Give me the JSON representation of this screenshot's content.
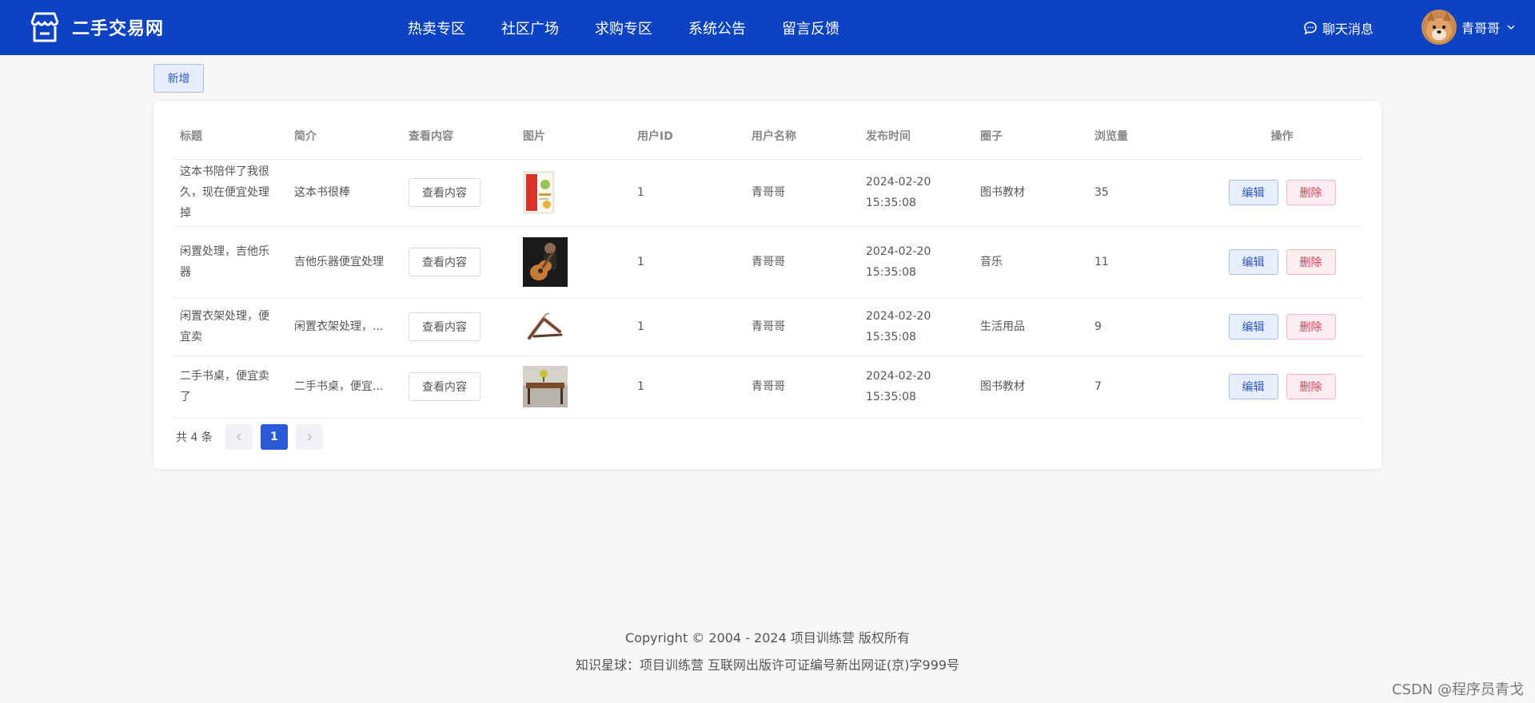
{
  "app": {
    "name": "二手交易网"
  },
  "nav": [
    "热卖专区",
    "社区广场",
    "求购专区",
    "系统公告",
    "留言反馈"
  ],
  "header": {
    "chat_label": "聊天消息",
    "user_name": "青哥哥"
  },
  "toolbar": {
    "add_label": "新增"
  },
  "table": {
    "columns": [
      "标题",
      "简介",
      "查看内容",
      "图片",
      "用户ID",
      "用户名称",
      "发布时间",
      "圈子",
      "浏览量",
      "操作"
    ],
    "rows": [
      {
        "title": "这本书陪伴了我很久，现在便宜处理掉",
        "intro": "这本书很棒",
        "view": "查看内容",
        "image": "book-cover",
        "user_id": "1",
        "user_name": "青哥哥",
        "time": "2024-02-20 15:35:08",
        "circle": "图书教材",
        "views": "35",
        "edit": "编辑",
        "delete": "删除"
      },
      {
        "title": "闲置处理，吉他乐器",
        "intro": "吉他乐器便宜处理",
        "view": "查看内容",
        "image": "guitar",
        "user_id": "1",
        "user_name": "青哥哥",
        "time": "2024-02-20 15:35:08",
        "circle": "音乐",
        "views": "11",
        "edit": "编辑",
        "delete": "删除"
      },
      {
        "title": "闲置衣架处理，便宜卖",
        "intro": "闲置衣架处理，...",
        "view": "查看内容",
        "image": "hanger",
        "user_id": "1",
        "user_name": "青哥哥",
        "time": "2024-02-20 15:35:08",
        "circle": "生活用品",
        "views": "9",
        "edit": "编辑",
        "delete": "删除"
      },
      {
        "title": "二手书桌，便宜卖了",
        "intro": "二手书桌，便宜...",
        "view": "查看内容",
        "image": "desk",
        "user_id": "1",
        "user_name": "青哥哥",
        "time": "2024-02-20 15:35:08",
        "circle": "图书教材",
        "views": "7",
        "edit": "编辑",
        "delete": "删除"
      }
    ]
  },
  "pagination": {
    "total_label": "共 4 条",
    "current_page": "1"
  },
  "footer": {
    "copyright": "Copyright © 2004 - 2024 项目训练营 版权所有",
    "license": "知识星球：项目训练营 互联网出版许可证编号新出网证(京)字999号"
  },
  "watermark": "CSDN @程序员青戈",
  "colors": {
    "header_bg": "#0b43c2",
    "primary": "#2a5bd7",
    "danger": "#e23b5b"
  }
}
